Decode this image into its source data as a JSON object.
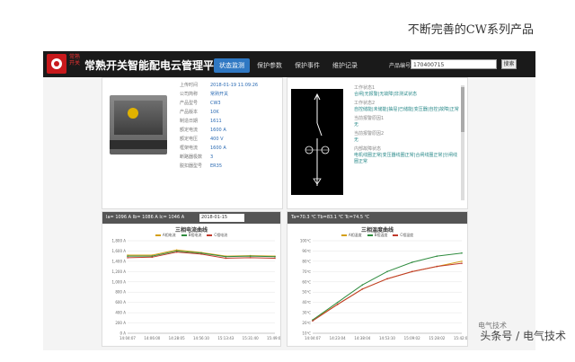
{
  "slide": {
    "title": "不断完善的CW系列产品"
  },
  "header": {
    "app_title": "常熟开关智能配电云管理平台",
    "brand_text": "常熟开关",
    "nav": [
      {
        "label": "状态监测",
        "active": true
      },
      {
        "label": "保护参数",
        "active": false
      },
      {
        "label": "保护事件",
        "active": false
      },
      {
        "label": "维护记录",
        "active": false
      }
    ],
    "search": {
      "label": "产品编号",
      "value": "170400715",
      "button": "搜索"
    }
  },
  "device_info": [
    {
      "k": "上传时间",
      "v": "2018-01-19 11:09:26"
    },
    {
      "k": "公司简称",
      "v": "常熟开关"
    },
    {
      "k": "产品型号",
      "v": "CW3"
    },
    {
      "k": "产品版本",
      "v": "10K"
    },
    {
      "k": "制造日期",
      "v": "1611"
    },
    {
      "k": "额定电流",
      "v": "1600 A"
    },
    {
      "k": "额定电压",
      "v": "400 V"
    },
    {
      "k": "框架电流",
      "v": "1600 A"
    },
    {
      "k": "断路器极数",
      "v": "3"
    },
    {
      "k": "脱扣器型号",
      "v": "ER35"
    }
  ],
  "status": [
    {
      "k": "工作状态1",
      "v": "合闸|无报警|无故障|非测试状态"
    },
    {
      "k": "工作状态2",
      "v": "自控储能|未储能|抽屉|已储能|变压器|自控|故障|正常"
    },
    {
      "k": "当前报警原因1",
      "v": "无"
    },
    {
      "k": "当前报警原因2",
      "v": "无"
    },
    {
      "k": "内部故障状态",
      "v": "电机线圈正常|变压器线圈正常|合闸线圈正常|分闸线圈正常"
    }
  ],
  "current_panel": {
    "bar_text": "Ia= 1096 A   Ib= 1086 A   Ic= 1046 A",
    "date": "2018-01-15"
  },
  "temp_panel": {
    "bar_text": "Ta=70.3 ℃   Tb=83.1 ℃   Tc=74.5 ℃"
  },
  "colors": {
    "a": "#d4a017",
    "b": "#2e8b3e",
    "c": "#c0392b"
  },
  "watermark": "头条号 / 电气技术",
  "wechat_mark": "电气技术",
  "chart_data": [
    {
      "type": "line",
      "title": "三相电流曲线",
      "x": [
        "14:04:07",
        "14:06:00",
        "14:28:05",
        "14:56:10",
        "15:13:43",
        "15:31:40",
        "15:49:00"
      ],
      "ylim": [
        0,
        1800
      ],
      "yticks": [
        "0 A",
        "200 A",
        "400 A",
        "600 A",
        "800 A",
        "1,000 A",
        "1,200 A",
        "1,400 A",
        "1,600 A",
        "1,800 A"
      ],
      "series": [
        {
          "name": "A相电流",
          "values": [
            1520,
            1520,
            1620,
            1570,
            1500,
            1510,
            1500
          ]
        },
        {
          "name": "B相电流",
          "values": [
            1500,
            1500,
            1600,
            1560,
            1490,
            1500,
            1490
          ]
        },
        {
          "name": "C相电流",
          "values": [
            1470,
            1480,
            1580,
            1540,
            1460,
            1470,
            1460
          ]
        }
      ]
    },
    {
      "type": "line",
      "title": "三相温度曲线",
      "x": [
        "14:04:07",
        "14:23:04",
        "14:38:04",
        "14:53:10",
        "15:09:02",
        "15:28:02",
        "15:42:00"
      ],
      "ylim": [
        10,
        100
      ],
      "yticks": [
        "10℃",
        "20℃",
        "30℃",
        "40℃",
        "50℃",
        "60℃",
        "70℃",
        "80℃",
        "90℃",
        "100℃"
      ],
      "series": [
        {
          "name": "A相温度",
          "values": [
            23,
            38,
            53,
            63,
            70,
            75,
            80
          ]
        },
        {
          "name": "B相温度",
          "values": [
            23,
            40,
            57,
            70,
            79,
            85,
            88
          ]
        },
        {
          "name": "C相温度",
          "values": [
            22,
            38,
            53,
            63,
            70,
            75,
            78
          ]
        }
      ]
    }
  ]
}
